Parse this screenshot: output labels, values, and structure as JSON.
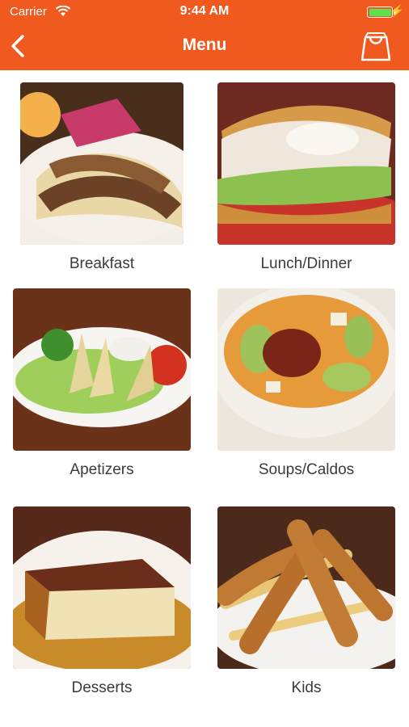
{
  "status_bar": {
    "carrier": "Carrier",
    "time": "9:44 AM"
  },
  "nav": {
    "title": "Menu",
    "back_icon": "chevron-left-icon",
    "cart_icon": "shopping-bag-icon"
  },
  "colors": {
    "header": "#f05a1e",
    "label": "#3b3b3b",
    "battery": "#62e04a"
  },
  "categories": [
    {
      "label": "Breakfast"
    },
    {
      "label": "Lunch/Dinner"
    },
    {
      "label": "Apetizers"
    },
    {
      "label": "Soups/Caldos"
    },
    {
      "label": "Desserts"
    },
    {
      "label": "Kids"
    }
  ]
}
